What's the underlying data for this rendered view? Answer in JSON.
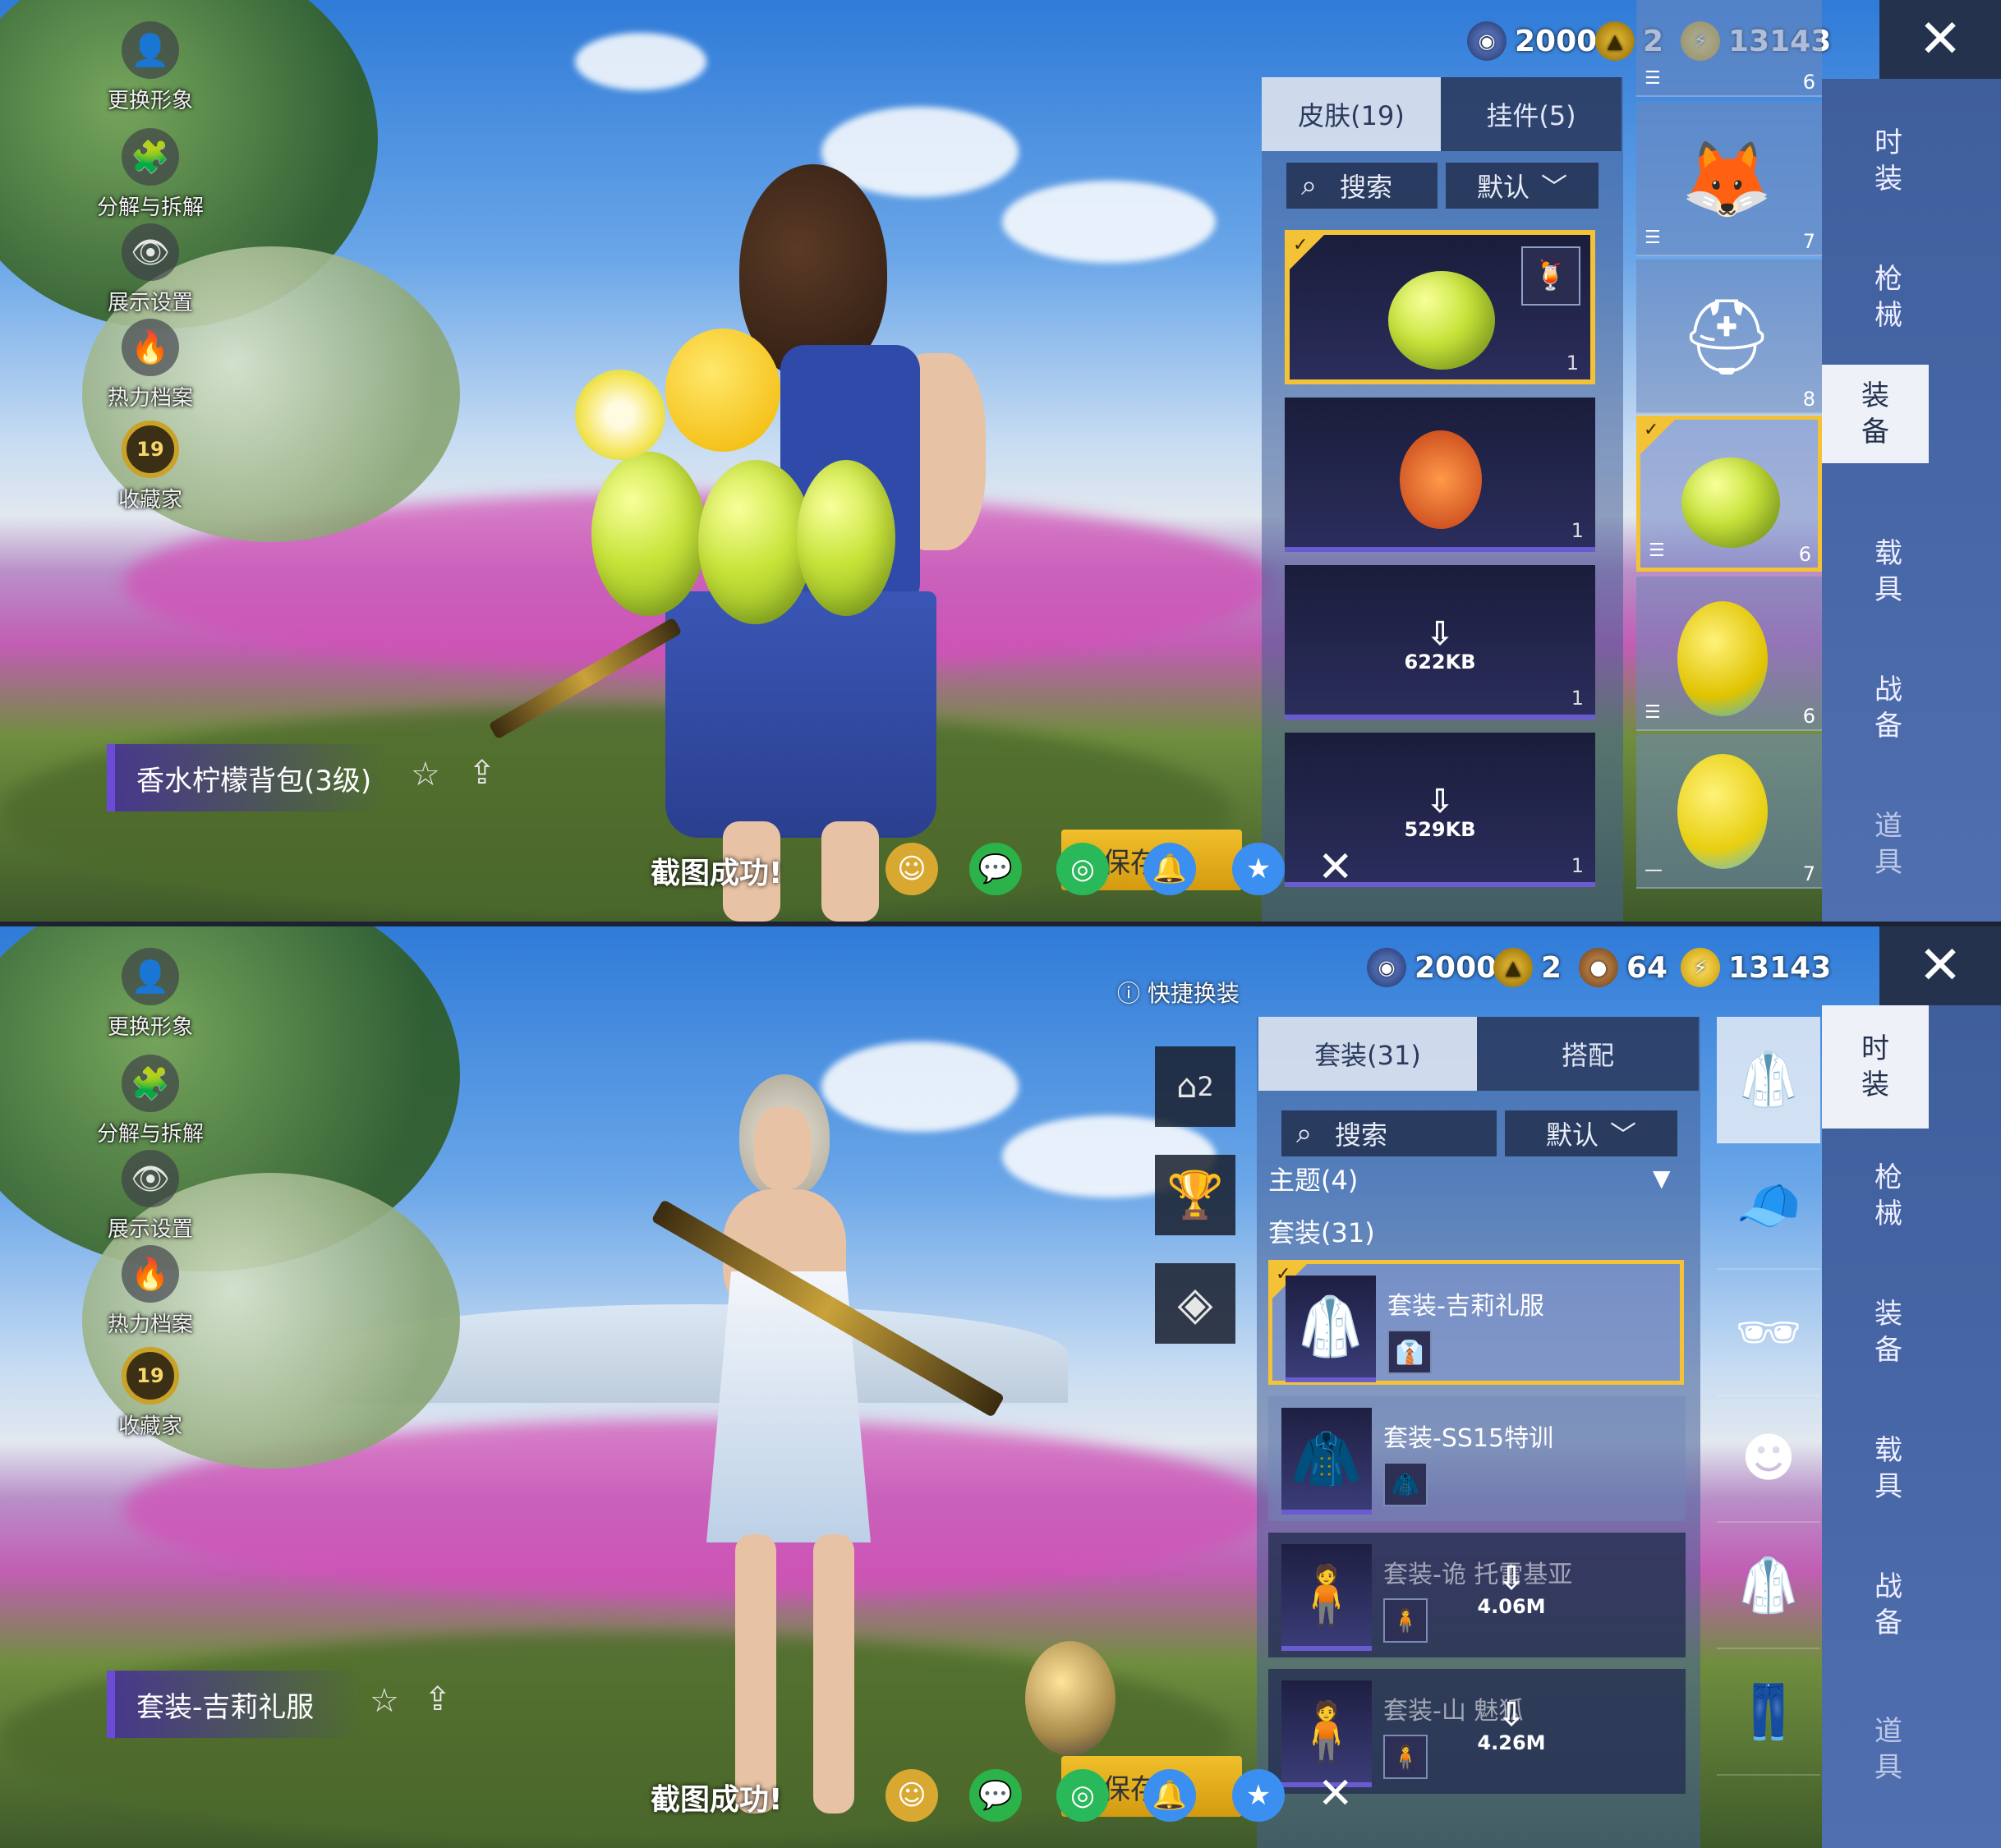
{
  "left_menu": {
    "change_look": "更换形象",
    "decompose": "分解与拆解",
    "display_settings": "展示设置",
    "heat_profile": "热力档案",
    "collector": "收藏家",
    "collector_level": "19"
  },
  "panel1": {
    "currency": [
      {
        "icon": "blue-coin-icon",
        "value": "2000"
      },
      {
        "icon": "gold-coin-icon",
        "value": "2"
      },
      {
        "icon": "lightning-coin-icon",
        "value": "13143"
      }
    ],
    "tabs": {
      "skin": "皮肤(19)",
      "pendant": "挂件(5)"
    },
    "search_placeholder": "搜索",
    "sort_label": "默认",
    "item_title": "香水柠檬背包(3级)",
    "cards": [
      {
        "count": "1",
        "download": ""
      },
      {
        "count": "1",
        "download": ""
      },
      {
        "count": "1",
        "download": "622KB"
      },
      {
        "count": "1",
        "download": "529KB"
      }
    ],
    "side_items": [
      {
        "count": "6"
      },
      {
        "count": "7"
      },
      {
        "count": "8"
      },
      {
        "count": "6"
      },
      {
        "count": "6"
      },
      {
        "count": "7"
      }
    ],
    "categories": [
      "时装",
      "枪械",
      "装备",
      "载具",
      "战备",
      "道具"
    ],
    "active_category": "装备"
  },
  "panel2": {
    "currency": [
      {
        "icon": "blue-coin-icon",
        "value": "2000"
      },
      {
        "icon": "gold-coin-icon",
        "value": "2"
      },
      {
        "icon": "bronze-coin-icon",
        "value": "64"
      },
      {
        "icon": "lightning-coin-icon",
        "value": "13143"
      }
    ],
    "quick_change": "快捷换装",
    "wardrobe_slot": "2",
    "tabs": {
      "suits": "套装(31)",
      "match": "搭配"
    },
    "search_placeholder": "搜索",
    "sort_label": "默认",
    "theme_section": "主题(4)",
    "suit_section": "套装(31)",
    "suits": [
      {
        "name": "套装-吉莉礼服",
        "download": ""
      },
      {
        "name": "套装-SS15特训",
        "download": ""
      },
      {
        "name": "套装-诡 托雷基亚",
        "download": "4.06M"
      },
      {
        "name": "套装-山 魅狐",
        "download": "4.26M"
      }
    ],
    "item_title": "套装-吉莉礼服",
    "categories": [
      "时装",
      "枪械",
      "装备",
      "载具",
      "战备",
      "道具"
    ],
    "active_category": "时装"
  },
  "share_bar": {
    "toast": "截图成功!",
    "save_label": "保存记"
  }
}
